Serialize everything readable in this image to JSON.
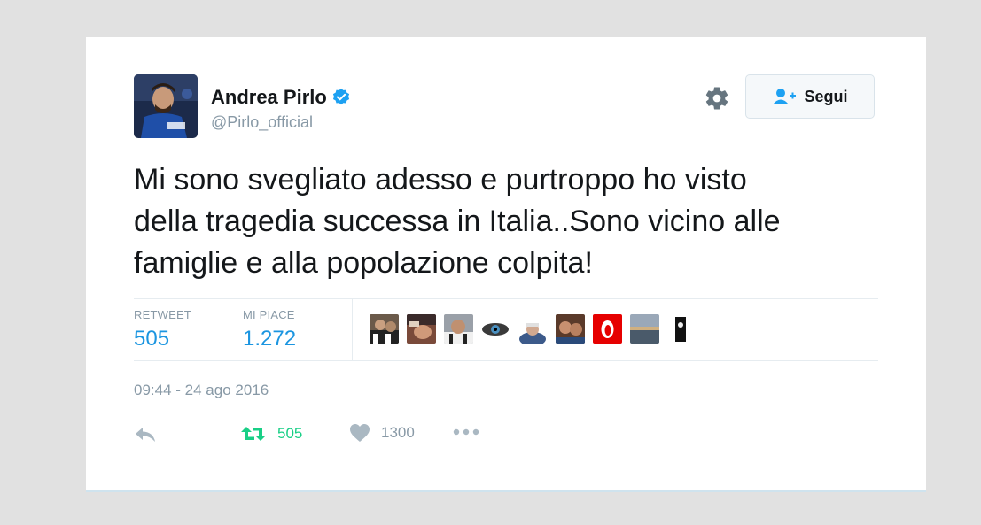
{
  "user": {
    "name": "Andrea Pirlo",
    "handle": "@Pirlo_official"
  },
  "follow_button": {
    "label": "Segui"
  },
  "tweet": {
    "lines": [
      "Mi sono svegliato adesso e purtroppo ho visto",
      "della tragedia successa in Italia..Sono vicino alle",
      "famiglie e alla popolazione colpita!"
    ]
  },
  "stats": {
    "retweet_label": "RETWEET",
    "retweet_value": "505",
    "like_label": "MI PIACE",
    "like_value": "1.272"
  },
  "timestamp": "09:44 - 24 ago 2016",
  "actions": {
    "retweet_count": "505",
    "like_count": "1300"
  },
  "colors": {
    "verified": "#1da1f2",
    "retweet_active": "#19cf86",
    "link_blue": "#1b95e0",
    "muted": "#8899a6"
  },
  "icons": [
    "verified-badge-icon",
    "gear-icon",
    "follow-person-icon",
    "reply-icon",
    "retweet-icon",
    "heart-icon",
    "more-icon"
  ]
}
